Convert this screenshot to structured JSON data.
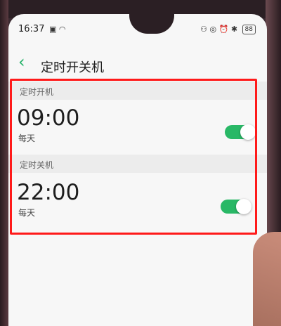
{
  "status_bar": {
    "time": "16:37",
    "left_icons": "▣ ◠",
    "right_icons": "⚇ ◎ ⏰ ✱",
    "battery": "88"
  },
  "header": {
    "back_icon": "chevron-left-icon",
    "title": "定时开关机"
  },
  "schedules": [
    {
      "section_label": "定时开机",
      "time": "09:00",
      "repeat": "每天",
      "enabled": true
    },
    {
      "section_label": "定时关机",
      "time": "22:00",
      "repeat": "每天",
      "enabled": true
    }
  ],
  "colors": {
    "accent": "#29b866",
    "highlight_border": "#ff1a1a"
  }
}
